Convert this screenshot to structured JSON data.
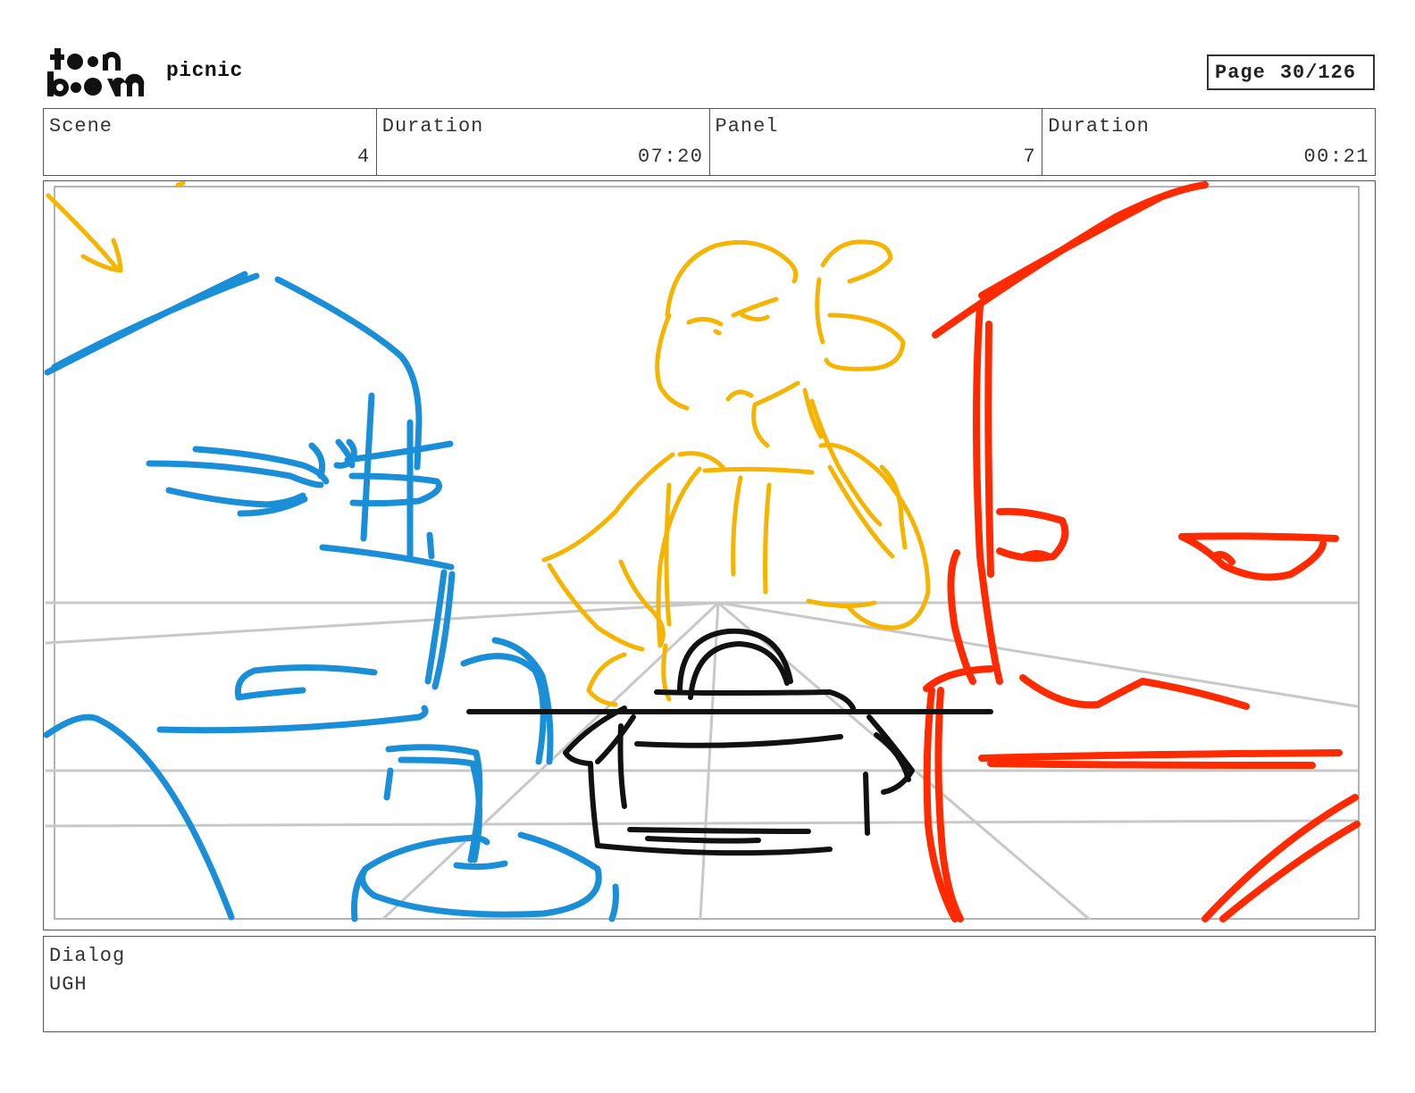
{
  "header": {
    "logo_icon": "toon-boom-logo",
    "logo_text": "toon boom",
    "project_name": "picnic",
    "page_label": "Page",
    "page_value": "30/126"
  },
  "info": {
    "scene_label": "Scene",
    "scene_value": "4",
    "scene_duration_label": "Duration",
    "scene_duration_value": "07:20",
    "panel_label": "Panel",
    "panel_value": "7",
    "panel_duration_label": "Duration",
    "panel_duration_value": "00:21"
  },
  "panel": {
    "image_icon": "storyboard-sketch",
    "colors": {
      "character_left": "#1a8fd8",
      "character_middle": "#f5b400",
      "character_right": "#ff2a00",
      "basket": "#111111",
      "perspective_guides": "#c8c8c8"
    }
  },
  "dialog": {
    "label": "Dialog",
    "text": "UGH"
  }
}
